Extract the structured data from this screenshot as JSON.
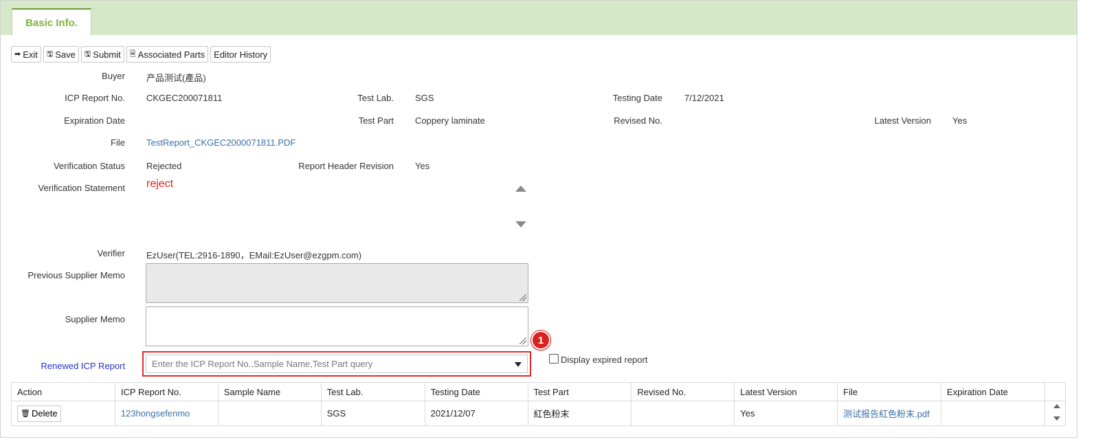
{
  "tab": {
    "label": "Basic Info."
  },
  "toolbar": {
    "exit": "Exit",
    "save": "Save",
    "submit": "Submit",
    "associated_parts": "Associated Parts",
    "editor_history": "Editor History"
  },
  "fields": {
    "buyer": {
      "label": "Buyer",
      "value": "产品测试(產品)"
    },
    "icp_report_no": {
      "label": "ICP Report No.",
      "value": "CKGEC200071811"
    },
    "test_lab": {
      "label": "Test Lab.",
      "value": "SGS"
    },
    "testing_date": {
      "label": "Testing Date",
      "value": "7/12/2021"
    },
    "expiration_date": {
      "label": "Expiration Date",
      "value": ""
    },
    "test_part": {
      "label": "Test Part",
      "value": "Coppery laminate"
    },
    "revised_no": {
      "label": "Revised No.",
      "value": ""
    },
    "latest_version": {
      "label": "Latest Version",
      "value": "Yes"
    },
    "file": {
      "label": "File",
      "value": "TestReport_CKGEC2000071811.PDF"
    },
    "verification_status": {
      "label": "Verification Status",
      "value": "Rejected"
    },
    "report_header_revision": {
      "label": "Report Header Revision",
      "value": "Yes"
    },
    "verification_statement": {
      "label": "Verification Statement",
      "value": "reject"
    },
    "verifier": {
      "label": "Verifier",
      "value": "EzUser(TEL:2916-1890，EMail:EzUser@ezgpm.com)"
    },
    "previous_supplier_memo": {
      "label": "Previous Supplier Memo"
    },
    "supplier_memo": {
      "label": "Supplier Memo"
    }
  },
  "renewed": {
    "label": "Renewed ICP Report",
    "placeholder": "Enter the ICP Report No.,Sample Name,Test Part query",
    "badge": "1",
    "display_expired": "Display expired report"
  },
  "table": {
    "headers": [
      "Action",
      "ICP Report No.",
      "Sample Name",
      "Test Lab.",
      "Testing Date",
      "Test Part",
      "Revised No.",
      "Latest Version",
      "File",
      "Expiration Date"
    ],
    "rows": [
      {
        "action": "Delete",
        "icp_report_no": "123hongsefenmo",
        "sample_name": "",
        "test_lab": "SGS",
        "testing_date": "2021/12/07",
        "test_part": "紅色粉末",
        "revised_no": "",
        "latest_version": "Yes",
        "file": "测试报告紅色粉末.pdf",
        "expiration_date": ""
      }
    ]
  },
  "colors": {
    "tabbar": "#d5e9c8",
    "tab_text": "#7bb63a",
    "link": "#3a6fa8",
    "reject": "#e11d1d",
    "renewed_label": "#2431c7",
    "highlight": "#e32a2a"
  }
}
